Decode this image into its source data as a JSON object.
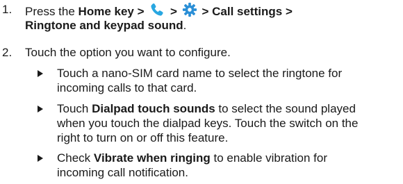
{
  "steps": [
    {
      "number": "1.",
      "parts": {
        "a": "Press the",
        "home": "Home",
        "b": "key",
        "sep1": ">",
        "sep2": ">",
        "sep3": ">",
        "call_settings": "Call settings",
        "sep4": ">",
        "ringtone": "Ringtone and keypad sound",
        "end": "."
      },
      "icons": [
        "phone-icon",
        "gear-icon"
      ]
    },
    {
      "number": "2.",
      "text": "Touch the option you want to configure."
    }
  ],
  "bullets": [
    {
      "line1": "Touch a nano-SIM card name to select the ringtone for",
      "line2": "incoming calls to that card."
    },
    {
      "pre": "Touch",
      "bold": "Dialpad touch sounds",
      "post1": "to select the sound played",
      "line2": "when you touch the dialpad keys. Touch the switch on the",
      "line3": "right to turn on or off this feature."
    },
    {
      "pre": "Check",
      "bold": "Vibrate when ringing",
      "post1": "to enable vibration for",
      "line2": "incoming call notification."
    }
  ],
  "colors": {
    "phone_icon": "#29a7e1",
    "gear_icon": "#2b8fd6",
    "text": "#1a1a1a"
  }
}
